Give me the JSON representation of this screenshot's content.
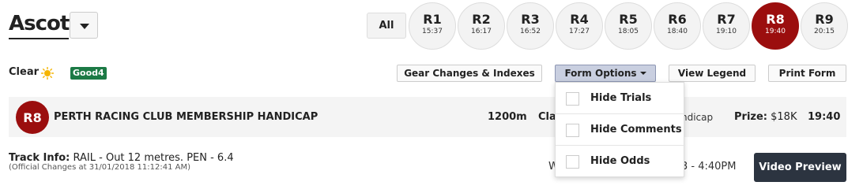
{
  "venue": {
    "name": "Ascot"
  },
  "races_nav": {
    "all_label": "All",
    "races": [
      {
        "num": "R1",
        "time": "15:37"
      },
      {
        "num": "R2",
        "time": "16:17"
      },
      {
        "num": "R3",
        "time": "16:52"
      },
      {
        "num": "R4",
        "time": "17:27"
      },
      {
        "num": "R5",
        "time": "18:05"
      },
      {
        "num": "R6",
        "time": "18:40"
      },
      {
        "num": "R7",
        "time": "19:10"
      },
      {
        "num": "R8",
        "time": "19:40",
        "active": true
      },
      {
        "num": "R9",
        "time": "20:15"
      }
    ]
  },
  "conditions": {
    "weather": "Clear",
    "track": "Good4",
    "weather_icon": "sun-icon"
  },
  "toolbar": {
    "gear_changes": "Gear Changes & Indexes",
    "form_options": "Form Options",
    "view_legend": "View Legend",
    "print_form": "Print Form"
  },
  "form_options_menu": [
    {
      "label": "Hide Trials",
      "checked": false
    },
    {
      "label": "Hide Comments",
      "checked": false
    },
    {
      "label": "Hide Odds",
      "checked": false
    }
  ],
  "race": {
    "badge": "R8",
    "name": "PERTH RACING CLUB MEMBERSHIP HANDICAP",
    "distance": "1200m",
    "class_partial": "Cla",
    "class_tail": "ndicap",
    "prize_label": "Prize:",
    "prize_value": "$18K",
    "time": "19:40"
  },
  "track_info": {
    "label": "Track Info:",
    "value": "RAIL - Out 12 metres. PEN - 6.4",
    "official": "(Official Changes at 31/01/2018 11:12:41 AM)",
    "right_partial": "W",
    "right_tail": "3 - 4:40PM"
  },
  "video_preview": "Video Preview",
  "colors": {
    "active_race": "#9b0e0e",
    "track_badge": "#1c7a45",
    "video_button": "#2c3440",
    "open_button": "#c9cfe0"
  }
}
